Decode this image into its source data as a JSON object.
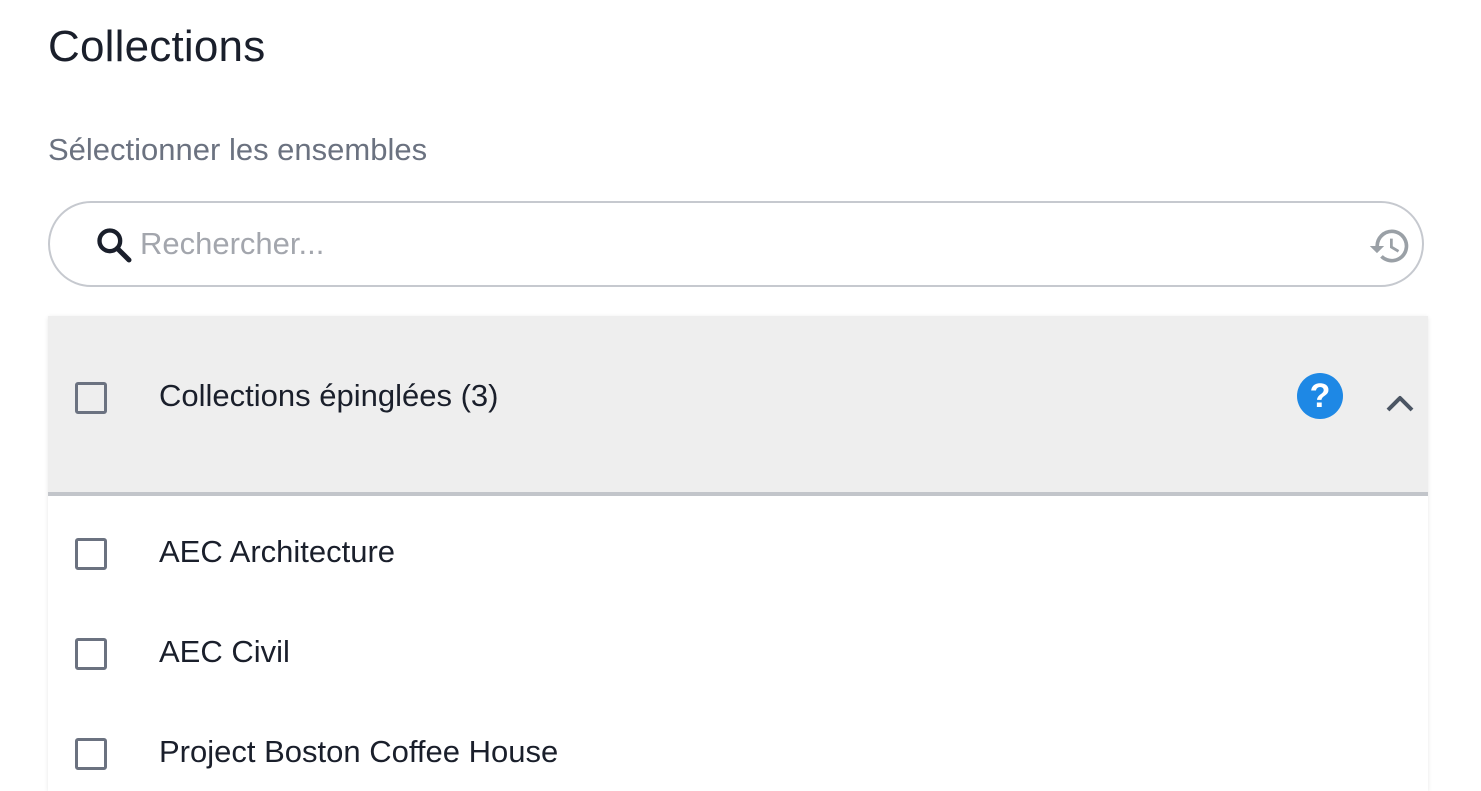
{
  "title": "Collections",
  "subtitle": "Sélectionner les ensembles",
  "search": {
    "placeholder": "Rechercher...",
    "value": ""
  },
  "pinned_group": {
    "label": "Collections épinglées (3)",
    "expanded": true,
    "checked": false
  },
  "items": [
    {
      "label": "AEC Architecture",
      "checked": false
    },
    {
      "label": "AEC Civil",
      "checked": false
    },
    {
      "label": "Project Boston Coffee House",
      "checked": false
    }
  ],
  "icons": {
    "search": "search-icon",
    "history": "history-icon",
    "help": "help-icon",
    "collapse": "chevron-up-icon",
    "help_glyph": "?"
  },
  "colors": {
    "help_accent": "#1e88e5",
    "header_bg": "#eeeeee"
  }
}
